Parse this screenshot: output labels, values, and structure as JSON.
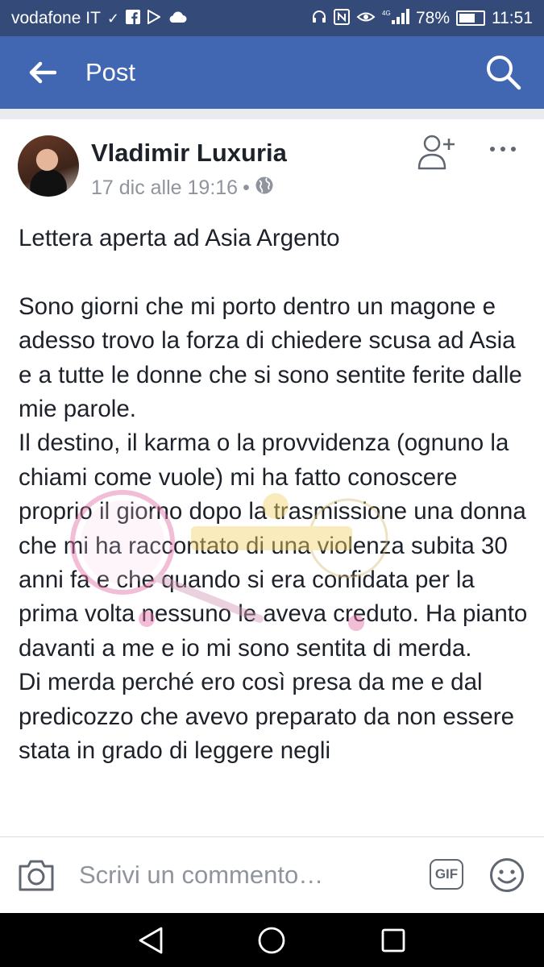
{
  "status_bar": {
    "carrier": "vodafone IT",
    "network": "4G",
    "battery": "78%",
    "battery_level": 0.78,
    "time": "11:51"
  },
  "app_bar": {
    "title": "Post"
  },
  "post": {
    "author": "Vladimir Luxuria",
    "timestamp": "17 dic alle 19:16",
    "separator": "•",
    "privacy_icon": "globe-icon",
    "text": "Lettera aperta ad Asia Argento\n\nSono giorni che mi porto dentro un magone e adesso trovo la forza di chiedere scusa ad Asia e a tutte le donne che si sono sentite ferite dalle mie parole.\nIl destino, il karma o la provvidenza (ognuno la chiami come vuole) mi ha fatto conoscere proprio il giorno dopo la trasmissione una donna che mi ha raccontato di una violenza subita 30 anni fa e che quando si era confidata per la prima volta nessuno le aveva creduto. Ha pianto davanti a me e io mi sono sentita di merda.\nDi merda perché ero così presa da me e dal predicozzo che avevo preparato da non essere stata in grado di leggere negli"
  },
  "comment_bar": {
    "placeholder": "Scrivi un commento…",
    "gif_label": "GIF"
  },
  "colors": {
    "status_bar": "#344a78",
    "app_bar": "#4267b2",
    "text": "#1d2129",
    "meta": "#90949c"
  }
}
